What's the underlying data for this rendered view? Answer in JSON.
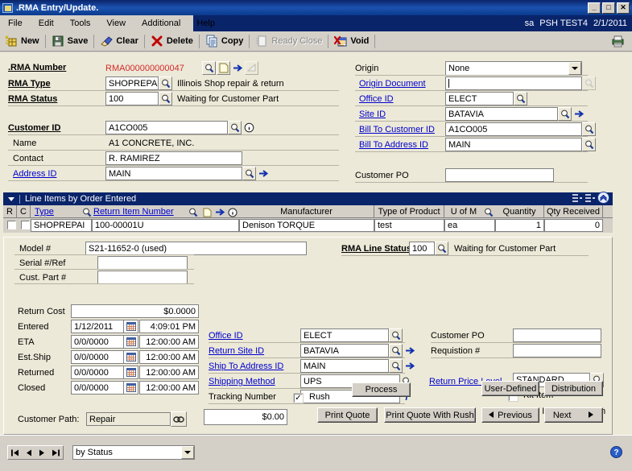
{
  "window": {
    "title": ".RMA Entry/Update.",
    "minimize": "_",
    "maximize": "□",
    "close": "✕"
  },
  "menu": {
    "items": [
      "File",
      "Edit",
      "Tools",
      "View",
      "Additional",
      "Help"
    ],
    "user": "sa",
    "company": "PSH TEST4",
    "date": "2/1/2011"
  },
  "toolbar": {
    "new": "New",
    "save": "Save",
    "clear": "Clear",
    "delete": "Delete",
    "copy": "Copy",
    "ready_close": "Ready Close",
    "void": "Void"
  },
  "header_left": {
    "rma_number_label": ".RMA Number",
    "rma_number_value": "RMA000000000047",
    "rma_number_color": "#d42a2a",
    "rma_type_label": "RMA Type",
    "rma_type_value": "SHOPREPA",
    "rma_type_desc": "Illinois Shop repair & return",
    "rma_status_label": "RMA Status",
    "rma_status_value": "100",
    "rma_status_desc": "Waiting for Customer Part",
    "customer_id_label": "Customer ID",
    "customer_id_value": "A1CO005",
    "name_label": "Name",
    "name_value": "A1 CONCRETE, INC.",
    "contact_label": "Contact",
    "contact_value": "R. RAMIREZ",
    "address_id_label": "Address ID",
    "address_id_value": "MAIN"
  },
  "header_right": {
    "origin_label": "Origin",
    "origin_value": "None",
    "origin_document_label": "Origin Document",
    "origin_document_value": "",
    "office_id_label": "Office ID",
    "office_id_value": "ELECT",
    "site_id_label": "Site ID",
    "site_id_value": "BATAVIA",
    "bill_to_customer_id_label": "Bill To Customer ID",
    "bill_to_customer_id_value": "A1CO005",
    "bill_to_address_id_label": "Bill To Address ID",
    "bill_to_address_id_value": "MAIN",
    "customer_po_label": "Customer PO",
    "customer_po_value": ""
  },
  "grid": {
    "band_title": "Line Items by Order Entered",
    "columns": [
      "R",
      "C",
      "Type",
      "Return Item Number",
      "Manufacturer",
      "Type of Product",
      "U of M",
      "Quantity",
      "Qty Received"
    ],
    "rows": [
      {
        "r_checked": false,
        "c_checked": false,
        "type": "SHOPREPAI",
        "return_item_number": "100-00001U",
        "manufacturer": "Denison TORQUE",
        "type_of_product": "test",
        "uom": "ea",
        "quantity": "1",
        "qty_received": "0"
      }
    ]
  },
  "detail": {
    "model_label": "Model #",
    "model_value": "S21-11652-0 (used)",
    "serial_label": "Serial #/Ref",
    "serial_value": "",
    "cust_part_label": "Cust. Part #",
    "cust_part_value": "",
    "rma_line_status_label": "RMA Line Status",
    "rma_line_status_value": "100",
    "rma_line_status_desc": "Waiting for Customer Part",
    "office_id_label": "Office ID",
    "office_id_value": "ELECT",
    "return_site_id_label": "Return Site ID",
    "return_site_id_value": "BATAVIA",
    "ship_to_address_id_label": "Ship To Address ID",
    "ship_to_address_id_value": "MAIN",
    "shipping_method_label": "Shipping Method",
    "shipping_method_value": "UPS",
    "tracking_number_label": "Tracking Number",
    "tracking_number_value": "",
    "customer_po_label": "Customer PO",
    "customer_po_value": "",
    "requistion_label": "Requistion #",
    "requistion_value": "",
    "return_price_level_label": "Return Price Level",
    "return_price_level_value": "STANDARD",
    "kit_item_label": "Kit Item",
    "kit_item_checked": false,
    "non_inventoried_label": "Non Inventoried Item",
    "non_inventoried_checked": false,
    "return_cost_label": "Return Cost",
    "return_cost_value": "$0.0000",
    "dates": [
      {
        "label": "Entered",
        "date": "1/12/2011",
        "time": "4:09:01 PM"
      },
      {
        "label": "ETA",
        "date": "0/0/0000",
        "time": "12:00:00 AM"
      },
      {
        "label": "Est.Ship",
        "date": "0/0/0000",
        "time": "12:00:00 AM"
      },
      {
        "label": "Returned",
        "date": "0/0/0000",
        "time": "12:00:00 AM"
      },
      {
        "label": "Closed",
        "date": "0/0/0000",
        "time": "12:00:00 AM"
      }
    ],
    "customer_path_label": "Customer Path:",
    "customer_path_value": "Repair",
    "total_value": "$0.00",
    "rush_label": "Rush",
    "rush_checked": true,
    "buttons": {
      "process": "Process",
      "user_defined": "User-Defined",
      "distribution": "Distribution",
      "print_quote": "Print Quote",
      "print_quote_with_rush": "Print Quote With Rush",
      "previous": "Previous",
      "next": "Next"
    }
  },
  "statusbar": {
    "sort_value": "by Status"
  }
}
